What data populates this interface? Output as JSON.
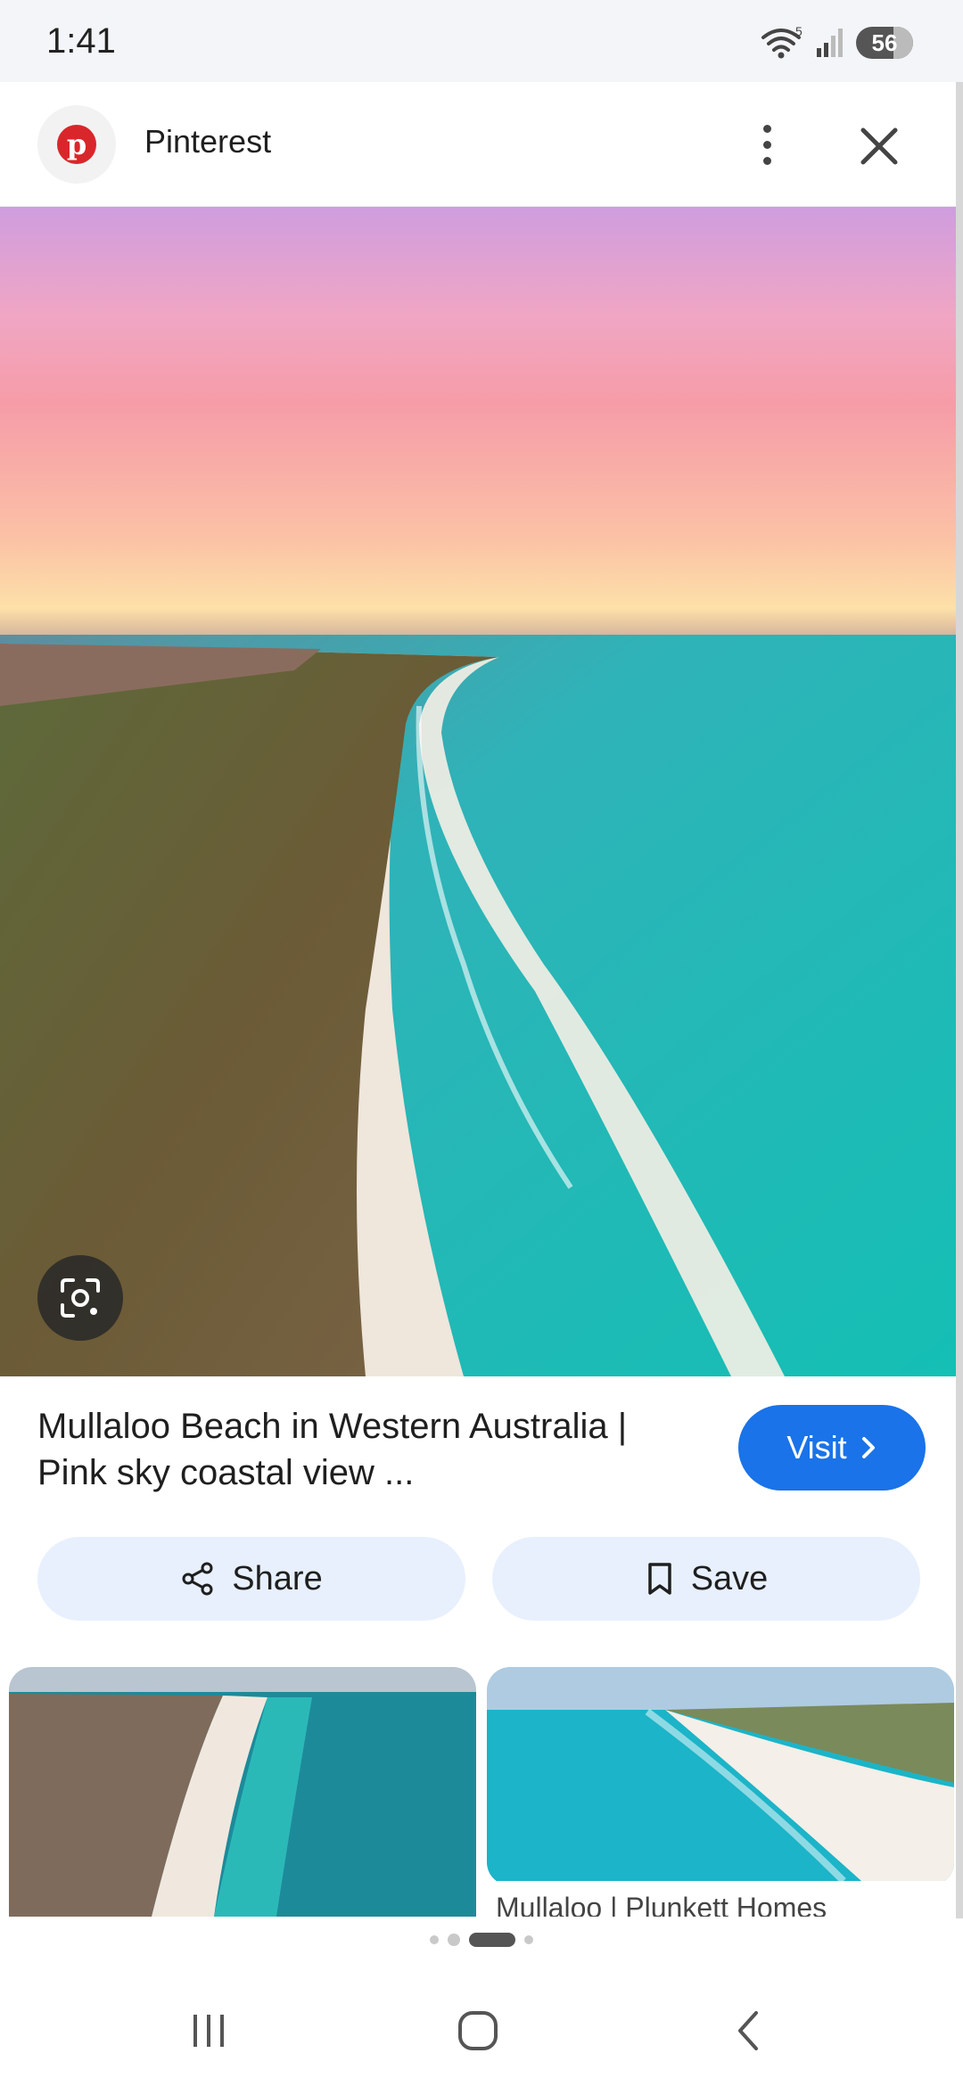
{
  "status_bar": {
    "time": "1:41",
    "battery": "56",
    "wifi_badge": "5"
  },
  "header": {
    "site_name": "Pinterest"
  },
  "result": {
    "title": "Mullaloo Beach in Western Australia | Pink sky coastal view ...",
    "visit_label": "Visit"
  },
  "actions": {
    "share_label": "Share",
    "save_label": "Save"
  },
  "related": [
    {
      "title": ""
    },
    {
      "title": "Mullaloo | Plunkett Homes"
    }
  ],
  "colors": {
    "accent": "#1a73e8",
    "action_bg": "#e8f0fe",
    "pinterest_red": "#d9262b"
  },
  "icons": {
    "share": "share-icon",
    "save": "bookmark-icon",
    "visit": "chevron-right-icon",
    "lens": "google-lens-icon",
    "close": "close-icon",
    "more": "more-vert-icon"
  }
}
